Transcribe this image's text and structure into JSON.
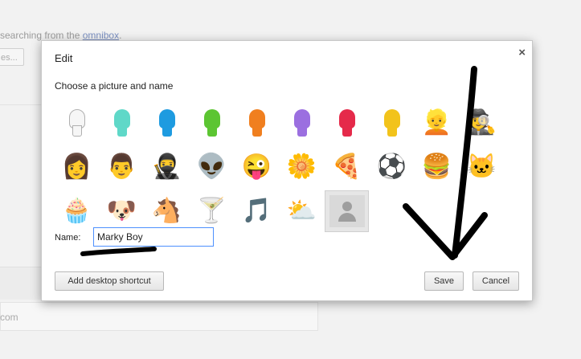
{
  "background": {
    "text_prefix": "searching from the ",
    "text_link": "omnibox",
    "text_suffix": ".",
    "button_label": "es...",
    "footer_text": "com"
  },
  "dialog": {
    "title": "Edit",
    "close_label": "×",
    "subtitle": "Choose a picture and name",
    "avatars": [
      {
        "type": "head",
        "color": "#ffffff",
        "icon": "white-avatar-icon"
      },
      {
        "type": "head",
        "color": "#5fd8c8",
        "icon": "teal-avatar-icon"
      },
      {
        "type": "head",
        "color": "#1e9be0",
        "icon": "blue-avatar-icon"
      },
      {
        "type": "head",
        "color": "#5cc532",
        "icon": "green-avatar-icon"
      },
      {
        "type": "head",
        "color": "#f07f1f",
        "icon": "orange-avatar-icon"
      },
      {
        "type": "head",
        "color": "#9b6fe0",
        "icon": "purple-avatar-icon"
      },
      {
        "type": "head",
        "color": "#e52a4a",
        "icon": "red-avatar-icon"
      },
      {
        "type": "head",
        "color": "#f2c31b",
        "icon": "yellow-avatar-icon"
      },
      {
        "type": "emoji",
        "glyph": "👱",
        "icon": "businessman-avatar-icon"
      },
      {
        "type": "emoji",
        "glyph": "🕵",
        "icon": "sunglasses-man-avatar-icon"
      },
      {
        "type": "emoji",
        "glyph": "👩",
        "icon": "woman-avatar-icon"
      },
      {
        "type": "emoji",
        "glyph": "👨",
        "icon": "man-avatar-icon"
      },
      {
        "type": "emoji",
        "glyph": "🥷",
        "icon": "ninja-avatar-icon"
      },
      {
        "type": "emoji",
        "glyph": "👽",
        "icon": "alien-avatar-icon"
      },
      {
        "type": "emoji",
        "glyph": "😜",
        "icon": "smiley-avatar-icon"
      },
      {
        "type": "emoji",
        "glyph": "🌼",
        "icon": "flower-avatar-icon"
      },
      {
        "type": "emoji",
        "glyph": "🍕",
        "icon": "pizza-avatar-icon"
      },
      {
        "type": "emoji",
        "glyph": "⚽",
        "icon": "soccer-ball-avatar-icon"
      },
      {
        "type": "emoji",
        "glyph": "🍔",
        "icon": "burger-avatar-icon"
      },
      {
        "type": "emoji",
        "glyph": "🐱",
        "icon": "cat-avatar-icon"
      },
      {
        "type": "emoji",
        "glyph": "🧁",
        "icon": "cupcake-avatar-icon"
      },
      {
        "type": "emoji",
        "glyph": "🐶",
        "icon": "dog-avatar-icon"
      },
      {
        "type": "emoji",
        "glyph": "🐴",
        "icon": "horse-avatar-icon"
      },
      {
        "type": "emoji",
        "glyph": "🍸",
        "icon": "cocktail-avatar-icon"
      },
      {
        "type": "emoji",
        "glyph": "🎵",
        "icon": "music-note-avatar-icon"
      },
      {
        "type": "emoji",
        "glyph": "⛅",
        "icon": "sun-cloud-avatar-icon"
      },
      {
        "type": "silhouette",
        "icon": "generic-profile-avatar-icon",
        "selected": true
      }
    ],
    "name_label": "Name:",
    "name_value": "Marky Boy",
    "add_shortcut_label": "Add desktop shortcut",
    "save_label": "Save",
    "cancel_label": "Cancel"
  }
}
